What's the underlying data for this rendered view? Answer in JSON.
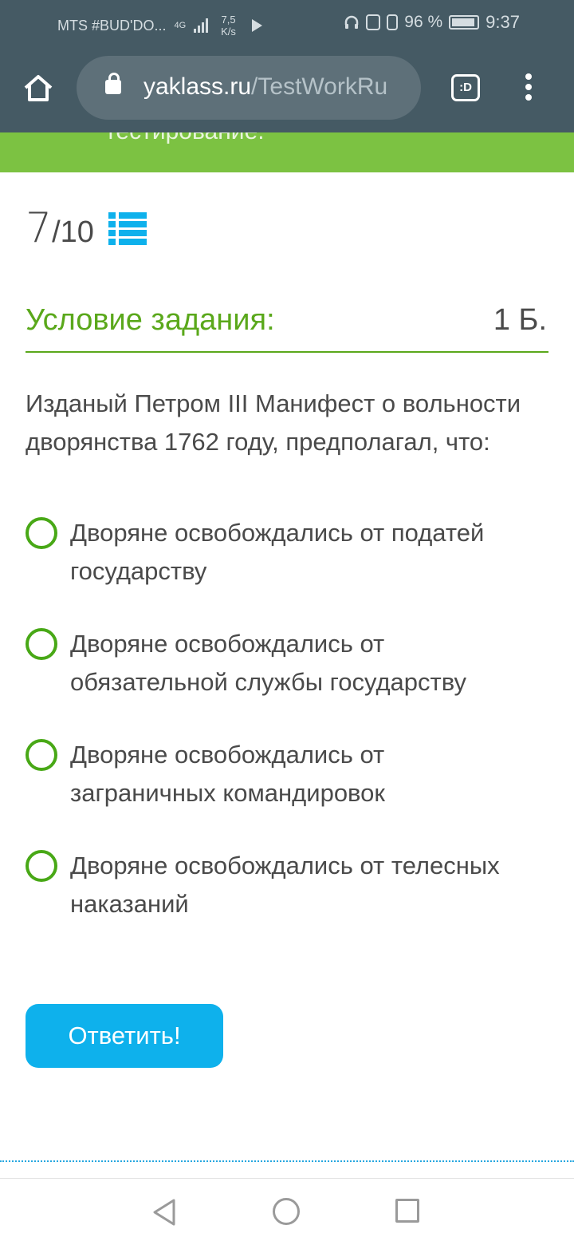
{
  "status_bar": {
    "carrier": "MTS #BUD'DO...",
    "network_type": "4G",
    "net_speed_value": "7,5",
    "net_speed_unit": "K/s",
    "battery": "96 %",
    "time": "9:37"
  },
  "browser": {
    "url_host": "yaklass.ru",
    "url_path": "/TestWorkRu",
    "tabs_label": ":D"
  },
  "banner": {
    "text": "тестирование."
  },
  "progress": {
    "current": "7",
    "total": "/10"
  },
  "task": {
    "heading": "Условие задания:",
    "points": "1 Б.",
    "question": "Изданый Петром III Манифест о вольности дворянства 1762 году, предполагал, что:"
  },
  "options": [
    {
      "label": "Дворяне освобождались от податей государству"
    },
    {
      "label": "Дворяне освобождались от обязательной службы государству"
    },
    {
      "label": "Дворяне освобождались от заграничных командировок"
    },
    {
      "label": "Дворяне освобождались от телесных наказаний"
    }
  ],
  "submit": {
    "label": "Ответить!"
  },
  "colors": {
    "chrome": "#455a64",
    "accent_green": "#5aa81b",
    "banner_green": "#7cc242",
    "button_blue": "#0eb1ec"
  }
}
